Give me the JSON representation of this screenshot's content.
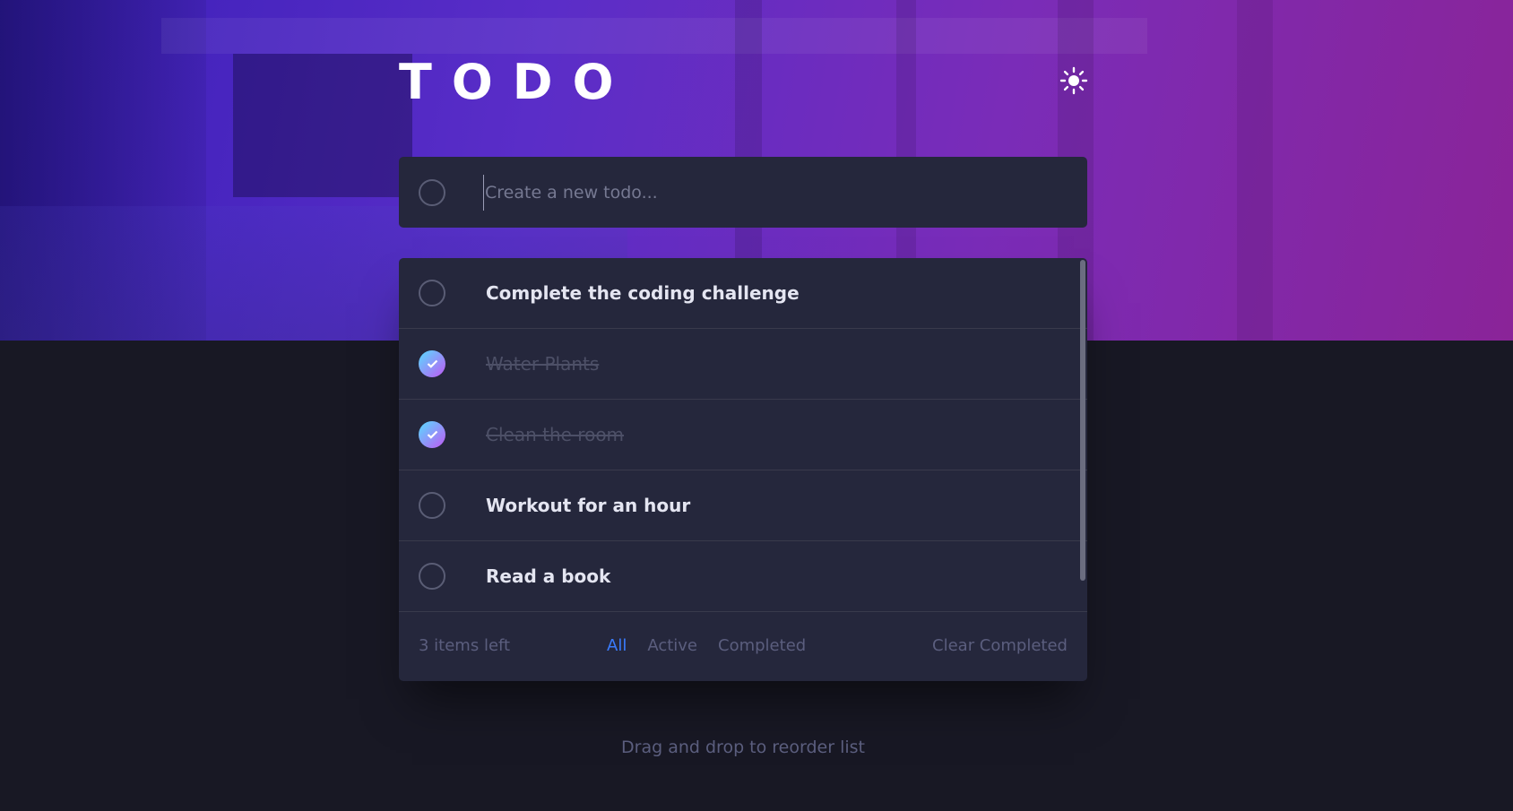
{
  "app": {
    "title": "TODO"
  },
  "header": {
    "theme_icon": "sun-icon"
  },
  "new_todo": {
    "placeholder": "Create a new todo..."
  },
  "todos": [
    {
      "text": "Complete the coding challenge",
      "completed": false
    },
    {
      "text": "Water Plants",
      "completed": true
    },
    {
      "text": "Clean the room",
      "completed": true
    },
    {
      "text": "Workout for an hour",
      "completed": false
    },
    {
      "text": "Read a book",
      "completed": false
    }
  ],
  "footer": {
    "items_left": "3 items left",
    "filters": [
      "All",
      "Active",
      "Completed"
    ],
    "active_filter": "All",
    "clear_label": "Clear Completed"
  },
  "hint": "Drag and drop to reorder list",
  "colors": {
    "accent": "#3a7cfd",
    "check_gradient_start": "#57ddff",
    "check_gradient_end": "#c058f3",
    "panel": "#25273c",
    "background": "#181824"
  }
}
